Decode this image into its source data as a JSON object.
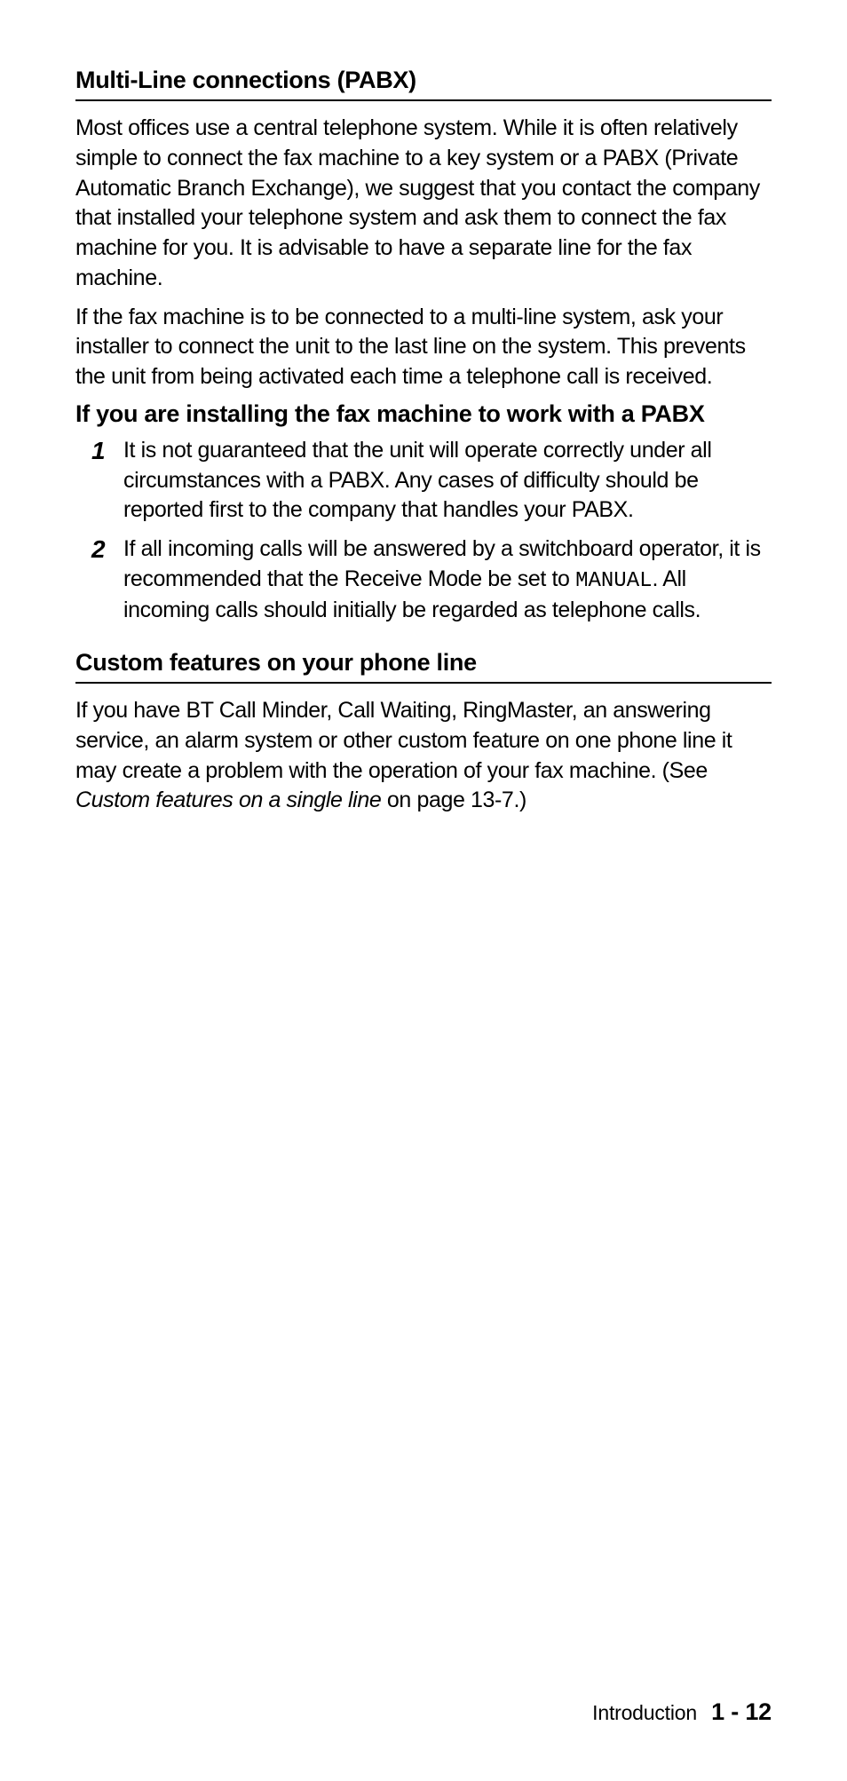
{
  "section1": {
    "heading": "Multi-Line connections (PABX)",
    "para1": "Most offices use a central telephone system. While it is often relatively simple to connect the fax machine to a key system or a PABX (Private Automatic Branch Exchange), we suggest that you contact the company that installed your telephone system and ask them to connect the fax machine for you. It is advisable to have a separate line for the fax machine.",
    "para2": "If the fax machine is to be connected to a multi-line system, ask your installer to connect the unit to the last line on the system. This prevents the unit from being activated each time a telephone call is received.",
    "subheading": "If you are installing the fax machine to work with a PABX",
    "items": [
      {
        "num": "1",
        "text": "It is not guaranteed that the unit will operate correctly under all circumstances with a PABX. Any cases of difficulty should be reported first to the company that handles your PABX."
      },
      {
        "num": "2",
        "pre": "If all incoming calls will be answered by a switchboard operator, it is recommended that the Receive Mode be set to ",
        "mono": "MANUAL",
        "post": ". All incoming calls should initially be regarded as telephone calls."
      }
    ]
  },
  "section2": {
    "heading": "Custom features on your phone line",
    "para_pre": "If you have BT Call Minder, Call Waiting, RingMaster, an answering service, an alarm system or other custom feature on one phone line it may create a problem with the operation of your fax machine. (See ",
    "para_italic": "Custom features on a single line",
    "para_post": " on page 13-7.)"
  },
  "footer": {
    "section": "Introduction",
    "page": "1 - 12"
  }
}
